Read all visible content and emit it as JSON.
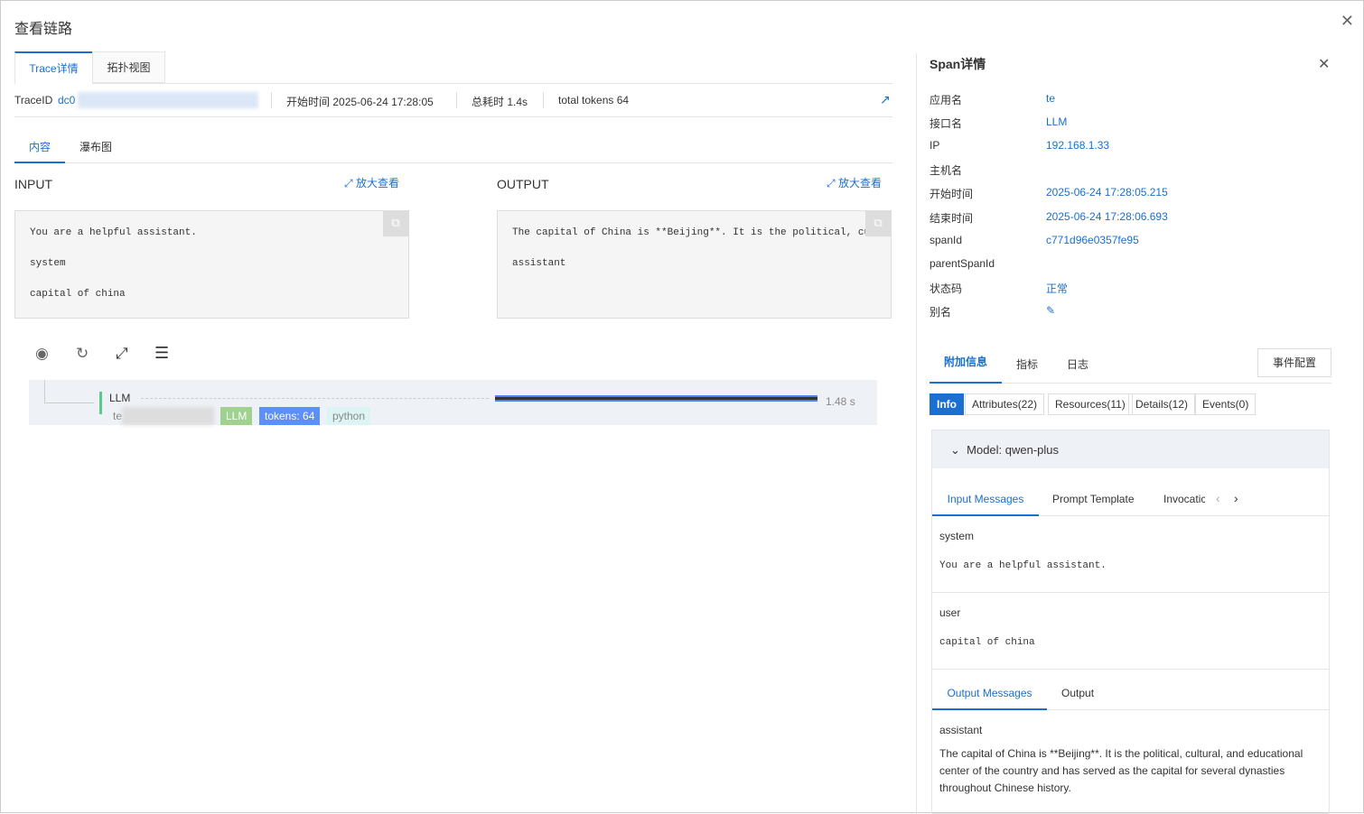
{
  "title": "查看链路",
  "tabs": [
    "Trace详情",
    "拓扑视图"
  ],
  "trace": {
    "id_label": "TraceID",
    "id_value": "dc0",
    "start_label": "开始时间",
    "start": "2025-06-24 17:28:05",
    "duration_label": "总耗时",
    "duration": "1.4s",
    "tokens_label": "total tokens",
    "tokens": "64"
  },
  "subtabs": [
    "内容",
    "瀑布图"
  ],
  "input": {
    "label": "INPUT",
    "zoom": "放大查看",
    "lines": [
      "You are a helpful assistant.",
      "system",
      "capital of china"
    ]
  },
  "output": {
    "label": "OUTPUT",
    "zoom": "放大查看",
    "lines": [
      "The capital of China is **Beijing**. It is the political, cultural, an",
      "assistant"
    ]
  },
  "span_row": {
    "name": "LLM",
    "service": "te",
    "tags": [
      "LLM",
      "tokens: 64",
      "python"
    ],
    "duration": "1.48 s",
    "progress": 1.0
  },
  "span": {
    "title": "Span详情",
    "fields": [
      {
        "k": "应用名",
        "v": "te"
      },
      {
        "k": "接口名",
        "v": "LLM"
      },
      {
        "k": "IP",
        "v": "192.168.1.33"
      },
      {
        "k": "主机名",
        "v": ""
      },
      {
        "k": "开始时间",
        "v": "2025-06-24 17:28:05.215"
      },
      {
        "k": "结束时间",
        "v": "2025-06-24 17:28:06.693"
      },
      {
        "k": "spanId",
        "v": "c771d96e0357fe95"
      },
      {
        "k": "parentSpanId",
        "v": ""
      },
      {
        "k": "状态码",
        "v": "正常"
      },
      {
        "k": "别名",
        "v": "✎"
      }
    ],
    "tabs": [
      "附加信息",
      "指标",
      "日志"
    ],
    "event_btn": "事件配置",
    "segs": [
      "Info",
      "Attributes(22)",
      "Resources(11)",
      "Details(12)",
      "Events(0)"
    ],
    "model": "Model: qwen-plus",
    "msg_tabs": [
      "Input Messages",
      "Prompt Template",
      "Invocatic"
    ],
    "messages": [
      {
        "role": "system",
        "text": "You are a helpful assistant."
      },
      {
        "role": "user",
        "text": "capital of china"
      }
    ],
    "out_tabs": [
      "Output Messages",
      "Output"
    ],
    "out_role": "assistant",
    "out_text": "The capital of China is **Beijing**. It is the political, cultural, and educational center of the country and has served as the capital for several dynasties throughout Chinese history."
  }
}
